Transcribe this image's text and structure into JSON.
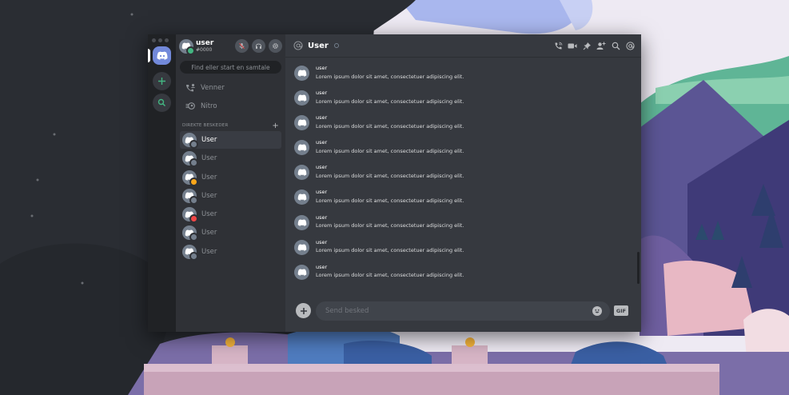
{
  "colors": {
    "brand": "#7289da",
    "online": "#43b581",
    "idle": "#faa61a",
    "dnd": "#f04747",
    "offline": "#747f8d"
  },
  "user_panel": {
    "username": "user",
    "tag": "#0000",
    "status": "online",
    "buttons": [
      "microphone-icon",
      "headphones-icon",
      "gear-icon"
    ]
  },
  "search": {
    "placeholder": "Find eller start en samtale"
  },
  "nav": [
    {
      "label": "Venner",
      "icon": "friends-icon"
    },
    {
      "label": "Nitro",
      "icon": "nitro-icon"
    }
  ],
  "dm_header": {
    "label": "DIREKTE BESKEDER",
    "add": "+"
  },
  "dms": [
    {
      "name": "User",
      "status": "offline",
      "active": true
    },
    {
      "name": "User",
      "status": "offline"
    },
    {
      "name": "User",
      "status": "idle"
    },
    {
      "name": "User",
      "status": "offline"
    },
    {
      "name": "User",
      "status": "dnd"
    },
    {
      "name": "User",
      "status": "offline"
    },
    {
      "name": "User",
      "status": "offline"
    }
  ],
  "chat": {
    "title": "User",
    "header_icons": [
      "call-icon",
      "video-icon",
      "pin-icon",
      "add-friend-icon",
      "search-icon",
      "mention-icon"
    ],
    "messages": [
      {
        "author": "user",
        "text": "Lorem ipsum dolor sit amet, consectetuer adipiscing elit."
      },
      {
        "author": "user",
        "text": "Lorem ipsum dolor sit amet, consectetuer adipiscing elit."
      },
      {
        "author": "user",
        "text": "Lorem ipsum dolor sit amet, consectetuer adipiscing elit."
      },
      {
        "author": "user",
        "text": "Lorem ipsum dolor sit amet, consectetuer adipiscing elit."
      },
      {
        "author": "user",
        "text": "Lorem ipsum dolor sit amet, consectetuer adipiscing elit."
      },
      {
        "author": "user",
        "text": "Lorem ipsum dolor sit amet, consectetuer adipiscing elit."
      },
      {
        "author": "user",
        "text": "Lorem ipsum dolor sit amet, consectetuer adipiscing elit."
      },
      {
        "author": "user",
        "text": "Lorem ipsum dolor sit amet, consectetuer adipiscing elit."
      },
      {
        "author": "user",
        "text": "Lorem ipsum dolor sit amet, consectetuer adipiscing elit."
      }
    ],
    "composer_placeholder": "Send besked",
    "gif_label": "GIF"
  }
}
